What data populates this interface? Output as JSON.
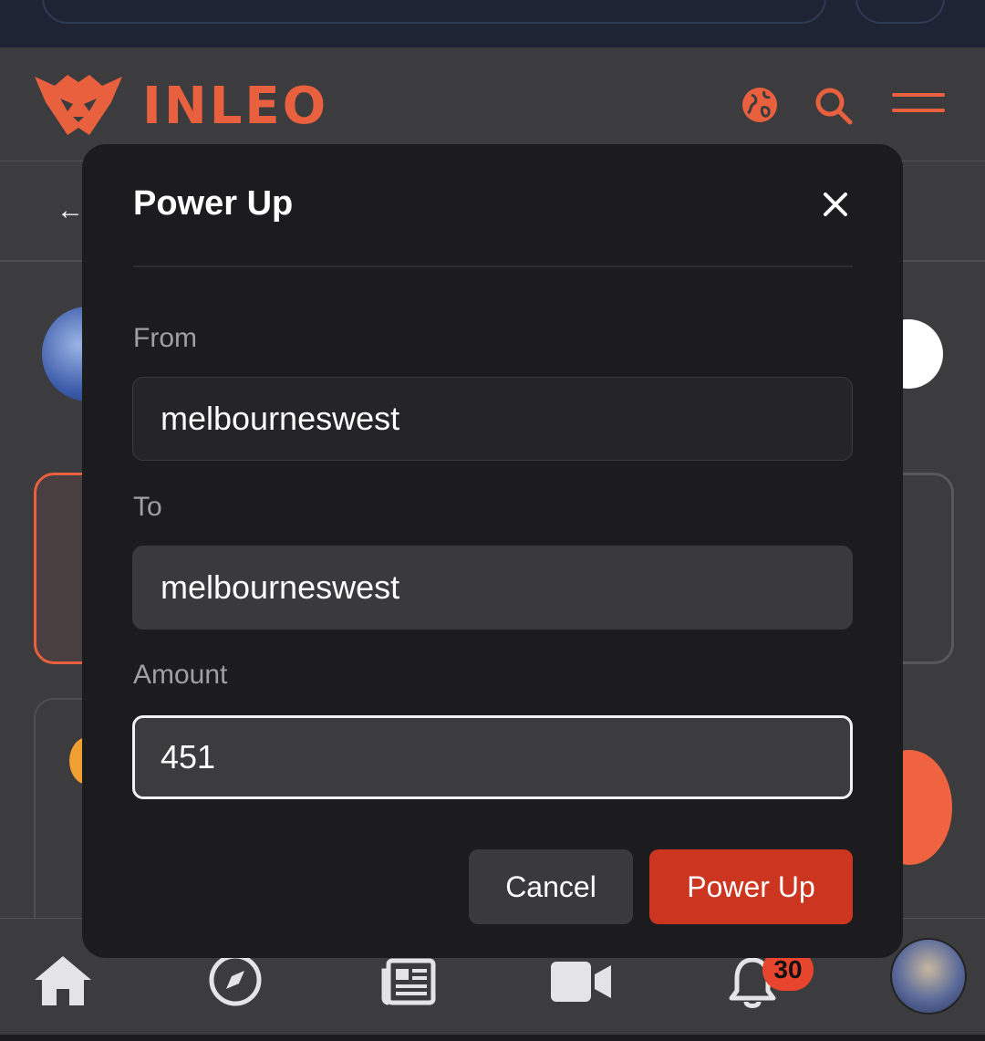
{
  "header": {
    "brand": "INLEO",
    "icons": [
      "globe-icon",
      "search-icon",
      "menu-icon"
    ]
  },
  "modal": {
    "title": "Power Up",
    "from_label": "From",
    "from_value": "melbourneswest",
    "to_label": "To",
    "to_value": "melbourneswest",
    "amount_label": "Amount",
    "amount_value": "451",
    "cancel_label": "Cancel",
    "submit_label": "Power Up"
  },
  "bottom_nav": {
    "items": [
      "home-icon",
      "compass-icon",
      "news-icon",
      "video-icon",
      "bell-icon",
      "avatar"
    ],
    "notification_count": "30"
  },
  "colors": {
    "accent": "#e8603e",
    "submit": "#cc3620",
    "modal_bg": "#1c1c1e",
    "page_bg": "#3c3c3e"
  }
}
